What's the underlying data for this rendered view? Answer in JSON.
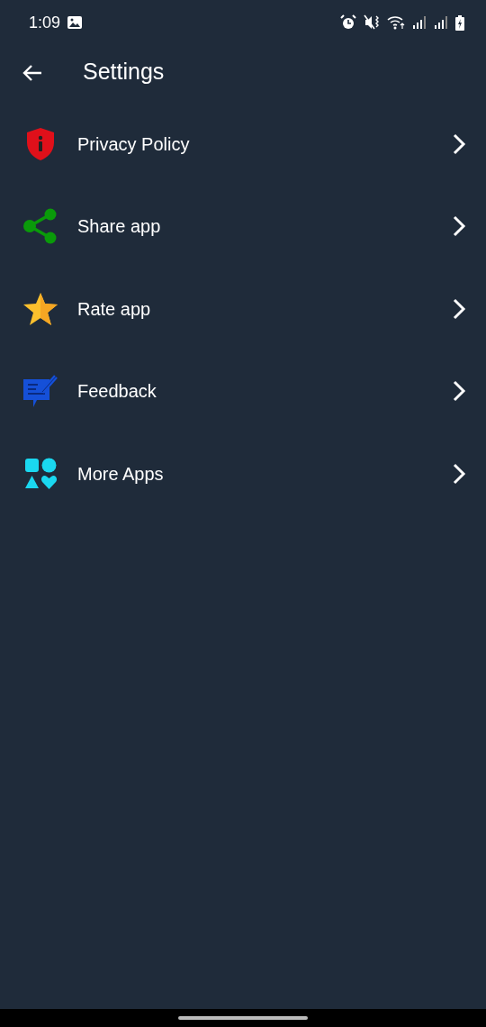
{
  "status_bar": {
    "time": "1:09"
  },
  "header": {
    "title": "Settings"
  },
  "items": [
    {
      "label": "Privacy Policy",
      "kind": "privacy"
    },
    {
      "label": "Share app",
      "kind": "share"
    },
    {
      "label": "Rate app",
      "kind": "rate"
    },
    {
      "label": "Feedback",
      "kind": "feedback"
    },
    {
      "label": "More Apps",
      "kind": "more"
    }
  ]
}
